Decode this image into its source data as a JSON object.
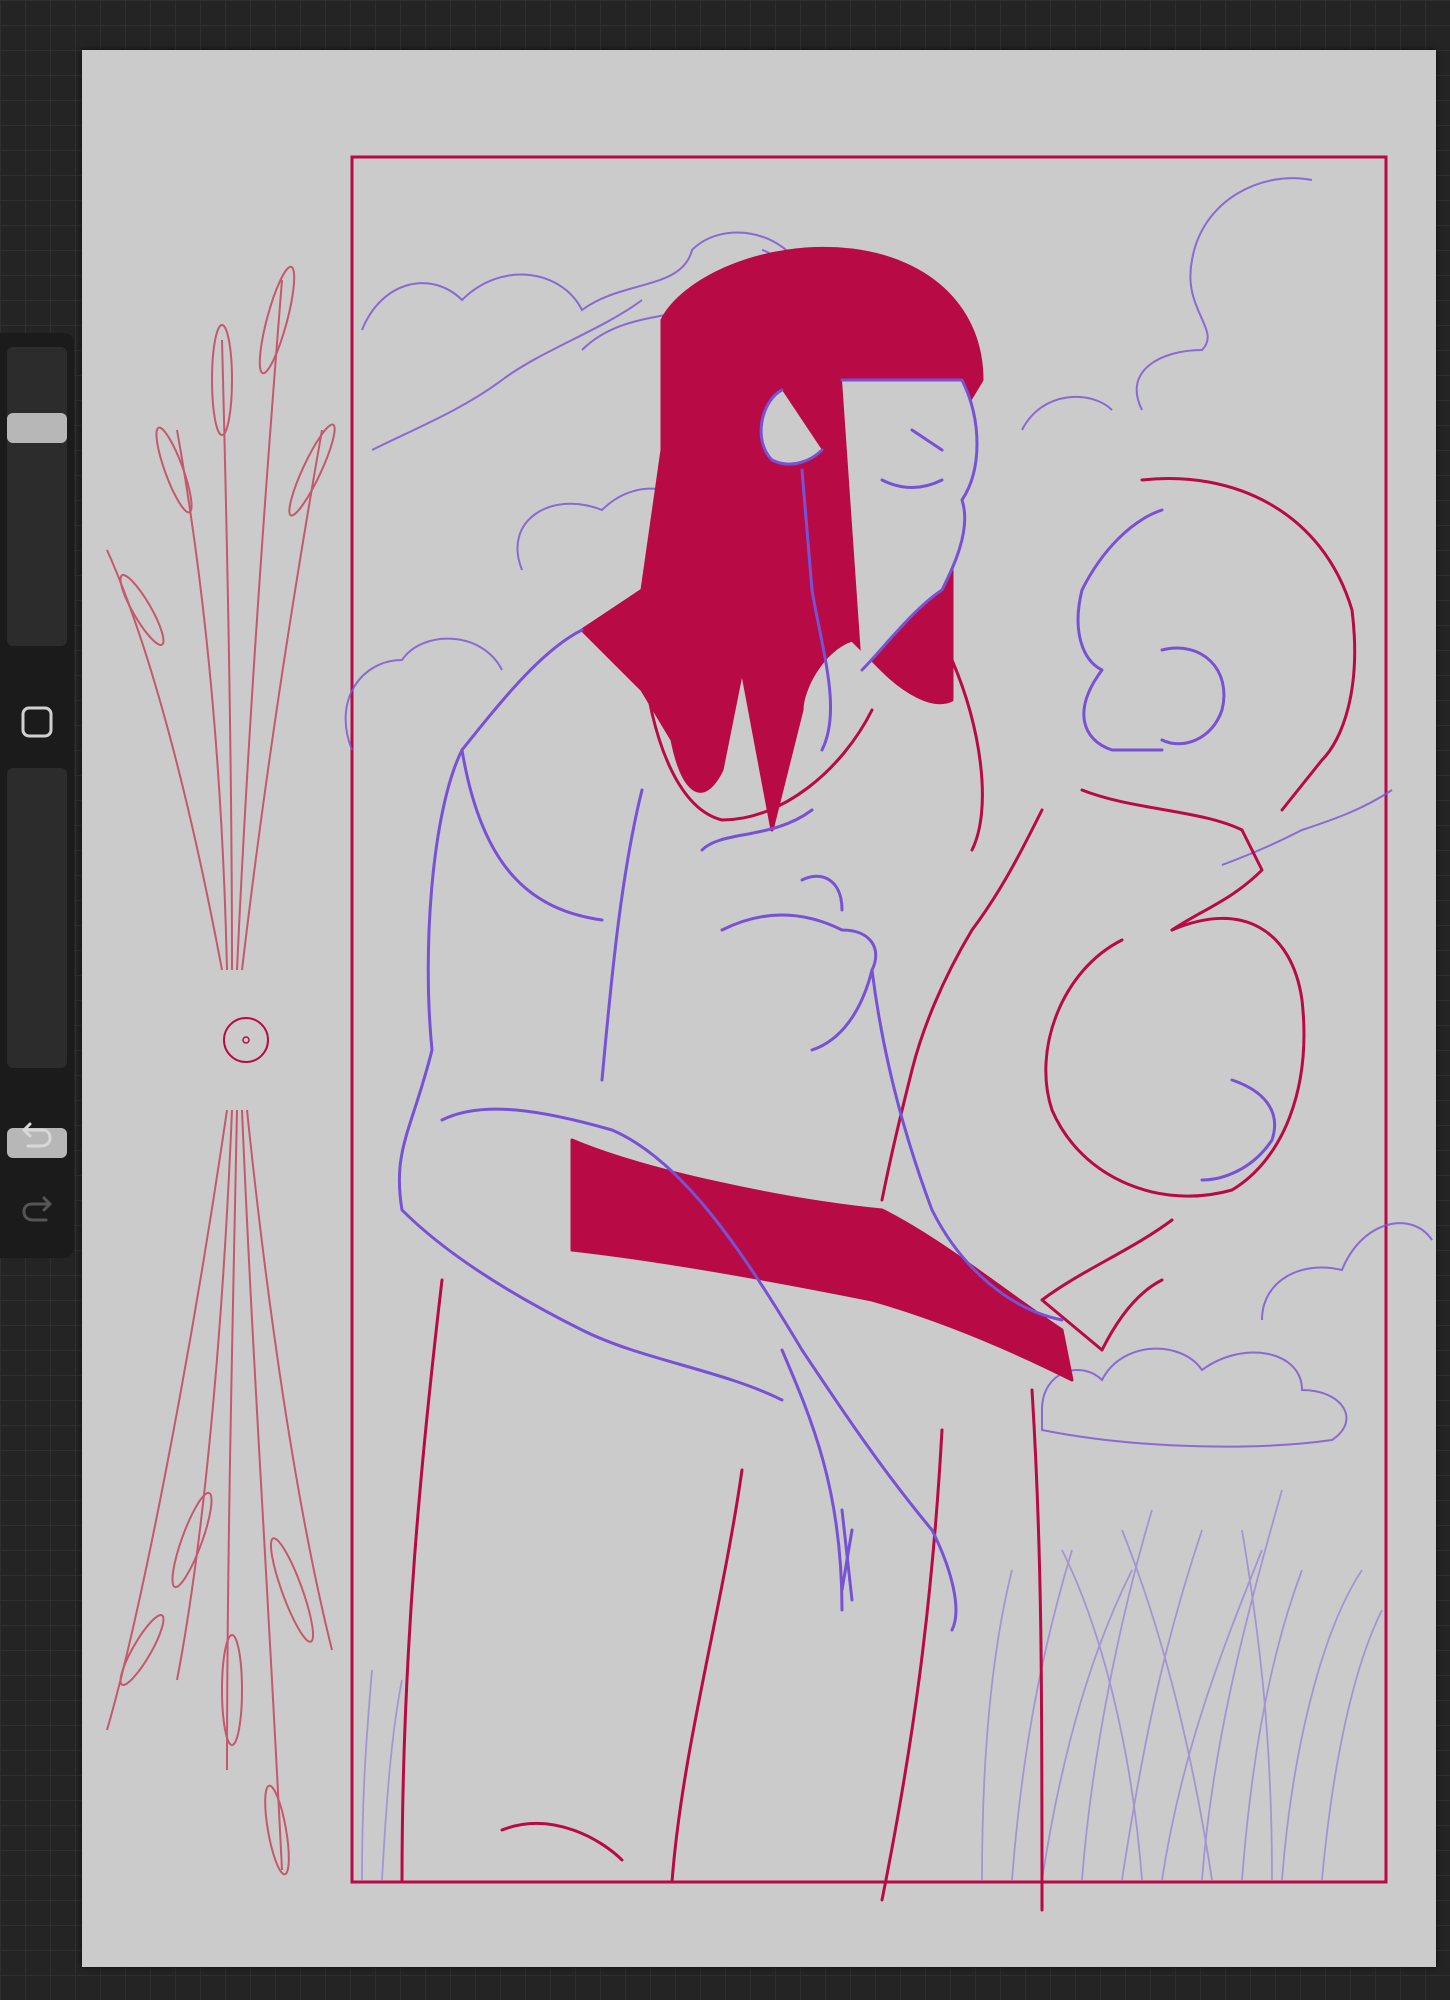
{
  "app": {
    "canvas_background": "#cbcbcb",
    "workspace_background": "#242424"
  },
  "sidebar": {
    "brush_size_slider": {
      "value": 0.17
    },
    "brush_opacity_slider": {
      "value": 0.95
    },
    "icons": [
      "modify-square-icon",
      "undo-icon",
      "redo-icon"
    ]
  },
  "artwork": {
    "ink_colors": {
      "crimson": "#b80a44",
      "violet": "#7752d4"
    }
  }
}
